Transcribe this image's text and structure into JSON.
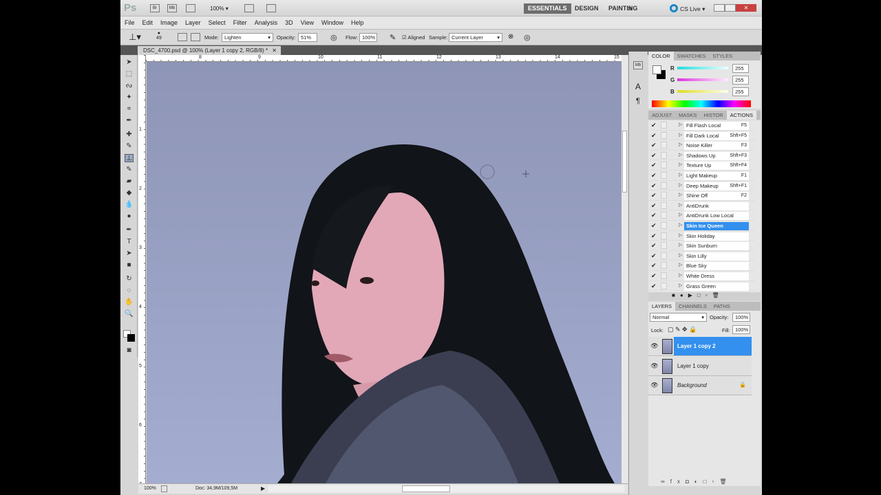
{
  "app": {
    "logo": "Ps",
    "zoom": "100%",
    "icons": [
      "bridge-icon",
      "mini-bridge-icon",
      "view-extras-icon",
      "arrange-documents-icon",
      "screen-mode-icon"
    ],
    "br": "Br",
    "mb": "Mb"
  },
  "workspaces": {
    "essentials": "ESSENTIALS",
    "design": "DESIGN",
    "painting": "PAINTING",
    "more": "»",
    "cslive": "CS Live ▾"
  },
  "menu": [
    "File",
    "Edit",
    "Image",
    "Layer",
    "Select",
    "Filter",
    "Analysis",
    "3D",
    "View",
    "Window",
    "Help"
  ],
  "options": {
    "brush_size": "49",
    "mode_label": "Mode:",
    "mode": "Lighten",
    "opacity_label": "Opacity:",
    "opacity": "51%",
    "flow_label": "Flow:",
    "flow": "100%",
    "aligned": "Aligned",
    "sample_label": "Sample:",
    "sample": "Current Layer"
  },
  "document": {
    "tab": "DSC_4700.psd @ 100% (Layer 1 copy 2, RGB/8) *",
    "ruler_top": [
      "8",
      "9",
      "10",
      "11",
      "12",
      "13",
      "14",
      "15"
    ],
    "ruler_left": [
      "1",
      "2",
      "3",
      "4",
      "5",
      "6",
      "7"
    ]
  },
  "status": {
    "zoom": "100%",
    "doc": "Doc: 34,9M/109,5M"
  },
  "color_panel": {
    "tabs": [
      "COLOR",
      "SWATCHES",
      "STYLES"
    ],
    "r_label": "R",
    "g_label": "G",
    "b_label": "B",
    "r": "255",
    "g": "255",
    "b": "255"
  },
  "actions_panel": {
    "tabs": [
      "ADJUST",
      "MASKS",
      "HISTOR",
      "ACTIONS"
    ],
    "items": [
      {
        "name": "Fill Flash Local",
        "key": "F5"
      },
      {
        "name": "Fill Dark Local",
        "key": "Shft+F5"
      },
      {
        "name": "Noise Killer",
        "key": "F3"
      },
      {
        "name": "Shadows Up",
        "key": "Shft+F3"
      },
      {
        "name": "Texture Up",
        "key": "Shft+F4"
      },
      {
        "name": "Light Makeup",
        "key": "F1"
      },
      {
        "name": "Deep Makeup",
        "key": "Shft+F1"
      },
      {
        "name": "Shine Off",
        "key": "F2"
      },
      {
        "name": "AntiDrunk",
        "key": ""
      },
      {
        "name": "AntiDrunk Low Local",
        "key": ""
      },
      {
        "name": "Skin Ice Queen",
        "key": "",
        "selected": true
      },
      {
        "name": "Skin Holiday",
        "key": ""
      },
      {
        "name": "Skin Sunburn",
        "key": ""
      },
      {
        "name": "Skin Lilly",
        "key": ""
      },
      {
        "name": "Blue Sky",
        "key": ""
      },
      {
        "name": "White Dress",
        "key": ""
      },
      {
        "name": "Grass Green",
        "key": ""
      }
    ]
  },
  "layers_panel": {
    "tabs": [
      "LAYERS",
      "CHANNELS",
      "PATHS"
    ],
    "blend": "Normal",
    "opacity_label": "Opacity:",
    "opacity": "100%",
    "lock_label": "Lock:",
    "fill_label": "Fill:",
    "fill": "100%",
    "layers": [
      {
        "name": "Layer 1 copy 2",
        "selected": true
      },
      {
        "name": "Layer 1 copy"
      },
      {
        "name": "Background",
        "locked": true
      }
    ]
  }
}
